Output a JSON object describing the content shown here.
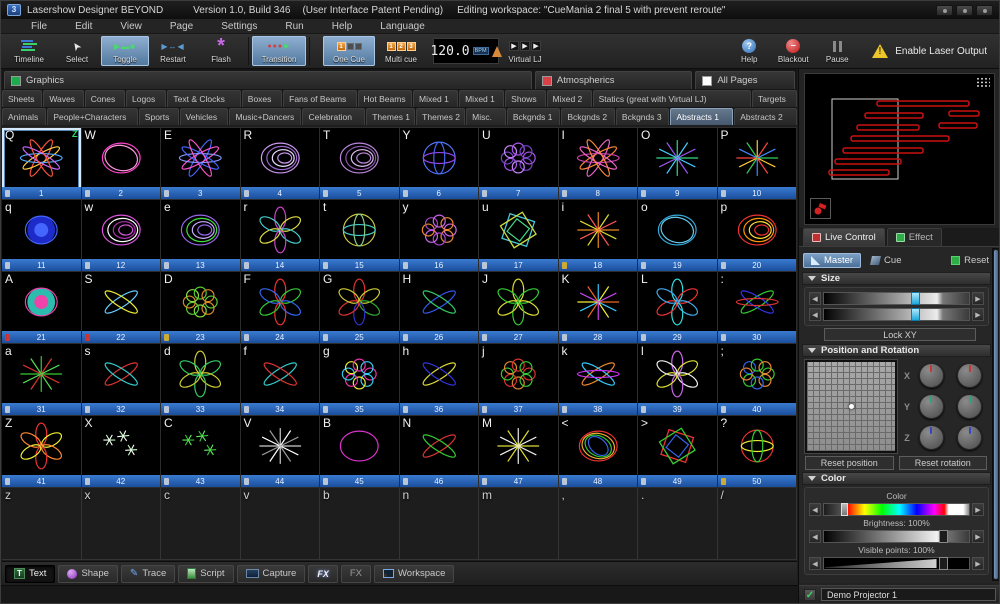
{
  "window": {
    "title": "Lasershow Designer BEYOND",
    "version": "Version 1.0, Build 346",
    "patent": "(User Interface Patent Pending)",
    "workspace": "Editing workspace: \"CueMania 2 final 5 with prevent reroute\""
  },
  "menu": {
    "items": [
      "File",
      "Edit",
      "View",
      "Page",
      "Settings",
      "Run",
      "Help",
      "Language"
    ]
  },
  "toolbar": {
    "buttons": [
      {
        "label": "Timeline",
        "active": false
      },
      {
        "label": "Select",
        "active": false
      },
      {
        "label": "Toggle",
        "active": true
      },
      {
        "label": "Restart",
        "active": false
      },
      {
        "label": "Flash",
        "active": false
      },
      {
        "label": "Transition",
        "active": true
      },
      {
        "label": "One Cue",
        "active": true
      },
      {
        "label": "Multi cue",
        "active": false
      }
    ],
    "bpm": "120.0",
    "bpm_unit": "BPM",
    "virtual_lj": "Virtual LJ",
    "right": [
      {
        "label": "Help"
      },
      {
        "label": "Blackout"
      },
      {
        "label": "Pause"
      }
    ],
    "enable_laser": "Enable Laser Output"
  },
  "page_tabs": [
    {
      "label": "Graphics",
      "color": "#1faa4e"
    },
    {
      "label": "Atmospherics",
      "color": "#d94048"
    },
    {
      "label": "All Pages",
      "color": "#ffffff"
    }
  ],
  "category_tabs": {
    "row1": [
      "Sheets",
      "Waves",
      "Cones",
      "Logos",
      "Text & Clocks",
      "Boxes",
      "Fans of Beams",
      "Hot Beams",
      "Mixed 1",
      "Mixed 1",
      "Shows",
      "Mixed 2",
      "Statics (great with Virtual LJ)",
      "Targets"
    ],
    "row2": [
      "Animals",
      "People+Characters",
      "Sports",
      "Vehicles",
      "Music+Dancers",
      "Celebration",
      "Themes 1",
      "Themes 2",
      "Misc.",
      "Bckgnds 1",
      "Bckgnds 2",
      "Bckgnds 3",
      "Abstracts 1",
      "Abstracts 2"
    ],
    "selected": "Abstracts 1"
  },
  "cue_grid": {
    "selected_indicator": "Z",
    "cells": [
      {
        "key": "Q",
        "num": "1",
        "sel": true,
        "type": "fan",
        "colors": [
          "#ff5540",
          "#ffcc44",
          "#55aaff",
          "#cc66ff"
        ]
      },
      {
        "key": "W",
        "num": "2",
        "type": "ring",
        "colors": [
          "#ff44cc",
          "#ff99dd"
        ]
      },
      {
        "key": "E",
        "num": "3",
        "type": "fan",
        "colors": [
          "#4466ff",
          "#ff55cc",
          "#8899ff"
        ]
      },
      {
        "key": "R",
        "num": "4",
        "type": "spiral",
        "colors": [
          "#cc99ee",
          "#9966cc",
          "#eeddff"
        ]
      },
      {
        "key": "T",
        "num": "5",
        "type": "spiral",
        "colors": [
          "#bb88dd",
          "#8855aa",
          "#ddbbee"
        ]
      },
      {
        "key": "Y",
        "num": "6",
        "type": "sphere",
        "colors": [
          "#5577ff",
          "#9944ee",
          "#4466ee"
        ]
      },
      {
        "key": "U",
        "num": "7",
        "type": "spiro",
        "colors": [
          "#aa55ee",
          "#7744cc",
          "#cc88ff"
        ]
      },
      {
        "key": "I",
        "num": "8",
        "type": "fan",
        "colors": [
          "#ee66cc",
          "#ff8833",
          "#cc44aa"
        ]
      },
      {
        "key": "O",
        "num": "9",
        "type": "burst",
        "colors": [
          "#33dd88",
          "#44ccff",
          "#9955ee"
        ]
      },
      {
        "key": "P",
        "num": "10",
        "type": "burst",
        "colors": [
          "#33cc55",
          "#ffcc33",
          "#ff4444",
          "#4488ff"
        ]
      },
      {
        "key": "q",
        "num": "11",
        "type": "blob",
        "colors": [
          "#2233ee",
          "#4466ff"
        ]
      },
      {
        "key": "w",
        "num": "12",
        "type": "spiral",
        "colors": [
          "#dd55dd",
          "#ffffff",
          "#aa33aa"
        ]
      },
      {
        "key": "e",
        "num": "13",
        "type": "spiral",
        "colors": [
          "#9966ee",
          "#44dd44",
          "#ccaaff"
        ]
      },
      {
        "key": "r",
        "num": "14",
        "type": "flower",
        "colors": [
          "#cc44cc",
          "#dddd44",
          "#44cccc"
        ]
      },
      {
        "key": "t",
        "num": "15",
        "type": "sphere",
        "colors": [
          "#cccc44",
          "#44cccc",
          "#88cc88"
        ]
      },
      {
        "key": "y",
        "num": "16",
        "type": "spiro",
        "colors": [
          "#cc66ee",
          "#ee8833",
          "#aa44cc"
        ]
      },
      {
        "key": "u",
        "num": "17",
        "type": "cube",
        "colors": [
          "#44ccdd",
          "#ccdd44",
          "#44dd88"
        ]
      },
      {
        "key": "i",
        "num": "18",
        "type": "burst",
        "colors": [
          "#ee8822",
          "#dddd33",
          "#ff5555"
        ],
        "badge": "#ccaa33"
      },
      {
        "key": "o",
        "num": "19",
        "type": "ring",
        "colors": [
          "#33aadd",
          "#66ccee"
        ]
      },
      {
        "key": "p",
        "num": "20",
        "type": "spiral",
        "colors": [
          "#ee3333",
          "#ff9900",
          "#ffdd33"
        ]
      },
      {
        "key": "A",
        "num": "21",
        "type": "blob",
        "colors": [
          "#33ddcc",
          "#ee44aa"
        ],
        "badge": "#cc3333"
      },
      {
        "key": "S",
        "num": "22",
        "type": "bowtie",
        "colors": [
          "#66ccff",
          "#eeee33"
        ],
        "badge": "#cc3333"
      },
      {
        "key": "D",
        "num": "23",
        "type": "spiro",
        "colors": [
          "#55cc33",
          "#dd8822",
          "#88dd44"
        ],
        "badge": "#ccaa33"
      },
      {
        "key": "F",
        "num": "24",
        "type": "flower",
        "colors": [
          "#ee3333",
          "#33cc33",
          "#3366ee"
        ]
      },
      {
        "key": "G",
        "num": "25",
        "type": "flower",
        "colors": [
          "#dd3333",
          "#cccc33",
          "#33aa33",
          "#3333cc"
        ]
      },
      {
        "key": "H",
        "num": "26",
        "type": "bowtie",
        "colors": [
          "#3355ee",
          "#33cc66"
        ]
      },
      {
        "key": "J",
        "num": "27",
        "type": "flower",
        "colors": [
          "#dddd33",
          "#33cc33"
        ]
      },
      {
        "key": "K",
        "num": "28",
        "type": "burst",
        "colors": [
          "#ee6622",
          "#33ccff",
          "#eeee33",
          "#cc44ee"
        ]
      },
      {
        "key": "L",
        "num": "29",
        "type": "flower",
        "colors": [
          "#33dddd",
          "#ee3333",
          "#44aaee"
        ]
      },
      {
        "key": ":",
        "num": "30",
        "type": "bowtie",
        "colors": [
          "#33cc33",
          "#3333ee",
          "#dd3333"
        ]
      },
      {
        "key": "a",
        "num": "31",
        "type": "burst",
        "colors": [
          "#33cc33",
          "#dd3333",
          "#55dd55"
        ]
      },
      {
        "key": "s",
        "num": "32",
        "type": "bowtie",
        "colors": [
          "#dd3333",
          "#33cccc"
        ]
      },
      {
        "key": "d",
        "num": "33",
        "type": "flower",
        "colors": [
          "#cccc33",
          "#33cc66"
        ]
      },
      {
        "key": "f",
        "num": "34",
        "type": "bowtie",
        "colors": [
          "#33cccc",
          "#dd3333"
        ]
      },
      {
        "key": "g",
        "num": "35",
        "type": "spiro",
        "colors": [
          "#ee33aa",
          "#33ccee",
          "#eeee33"
        ]
      },
      {
        "key": "h",
        "num": "36",
        "type": "bowtie",
        "colors": [
          "#dddd33",
          "#3333dd"
        ]
      },
      {
        "key": "j",
        "num": "37",
        "type": "spiro",
        "colors": [
          "#dd3333",
          "#33cc33",
          "#dd8833"
        ]
      },
      {
        "key": "k",
        "num": "38",
        "type": "bowtie",
        "colors": [
          "#ee8833",
          "#33ccff",
          "#cc33ee"
        ]
      },
      {
        "key": "l",
        "num": "39",
        "type": "flower",
        "colors": [
          "#cc66ee",
          "#dddd33",
          "#eeeeee"
        ]
      },
      {
        "key": ";",
        "num": "40",
        "type": "spiro",
        "colors": [
          "#33cc33",
          "#ee8833",
          "#3366ee"
        ]
      },
      {
        "key": "Z",
        "num": "41",
        "type": "flower",
        "colors": [
          "#ee3333",
          "#eeee33",
          "#ff8833"
        ]
      },
      {
        "key": "X",
        "num": "42",
        "type": "stars",
        "colors": [
          "#ccffcc",
          "#ffffff"
        ]
      },
      {
        "key": "C",
        "num": "43",
        "type": "stars",
        "colors": [
          "#33cc33",
          "#66ee66"
        ]
      },
      {
        "key": "V",
        "num": "44",
        "type": "burst",
        "colors": [
          "#cccccc",
          "#ffffff",
          "#999999"
        ]
      },
      {
        "key": "B",
        "num": "45",
        "type": "ring",
        "colors": [
          "#dd33cc"
        ]
      },
      {
        "key": "N",
        "num": "46",
        "type": "bowtie",
        "colors": [
          "#dd3333",
          "#33cc33"
        ]
      },
      {
        "key": "M",
        "num": "47",
        "type": "burst",
        "colors": [
          "#dddd33",
          "#eeeeee"
        ]
      },
      {
        "key": "<",
        "num": "48",
        "type": "ring",
        "colors": [
          "#ee3333",
          "#eeaa33",
          "#33cc33",
          "#3366ee"
        ]
      },
      {
        "key": ">",
        "num": "49",
        "type": "cube",
        "colors": [
          "#ee3333",
          "#33cc33",
          "#3366ee",
          "#eeee33"
        ]
      },
      {
        "key": "?",
        "num": "50",
        "type": "sphere",
        "colors": [
          "#ee3333",
          "#eeee33",
          "#33cc33",
          "#3366ee"
        ],
        "badge": "#ccaa33"
      },
      {
        "key": "z",
        "empty": true
      },
      {
        "key": "x",
        "empty": true
      },
      {
        "key": "c",
        "empty": true
      },
      {
        "key": "v",
        "empty": true
      },
      {
        "key": "b",
        "empty": true
      },
      {
        "key": "n",
        "empty": true
      },
      {
        "key": "m",
        "empty": true
      },
      {
        "key": ",",
        "empty": true
      },
      {
        "key": ".",
        "empty": true
      },
      {
        "key": "/",
        "empty": true
      }
    ]
  },
  "live_control": {
    "tabs": [
      {
        "label": "Live Control"
      },
      {
        "label": "Effect"
      }
    ],
    "master": "Master",
    "cue": "Cue",
    "reset": "Reset",
    "size": {
      "title": "Size",
      "lock": "Lock XY"
    },
    "posrot": {
      "title": "Position and Rotation",
      "axes": [
        "X",
        "Y",
        "Z"
      ],
      "axis_colors": [
        "#cc3333",
        "#2aa384",
        "#3344cc"
      ],
      "reset_position": "Reset position",
      "reset_rotation": "Reset rotation"
    },
    "color": {
      "title": "Color",
      "color_label": "Color",
      "brightness_label": "Brightness: 100%",
      "visible_label": "Visible points: 100%"
    }
  },
  "projector": {
    "label": "Demo Projector 1"
  },
  "bottom_toolbar": {
    "buttons": [
      "Text",
      "Shape",
      "Trace",
      "Script",
      "Capture",
      "FX",
      "FX",
      "Workspace"
    ]
  },
  "colors": {
    "accent_blue": "#5a87b5",
    "cue_bar_blue": "#1e5fae",
    "laser_red": "#cc1111",
    "warning_yellow": "#ecc52a",
    "enabled_green": "#2fae48"
  }
}
